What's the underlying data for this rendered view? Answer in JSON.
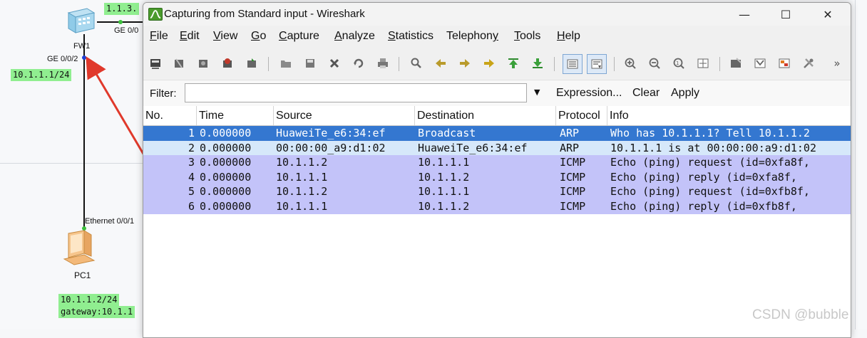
{
  "topology": {
    "fw_ip_label": "1.1.3.",
    "fw_port_top": "GE 0/0",
    "fw_name": "FW1",
    "fw_port_left": "GE 0/0/2",
    "fw_ip": "10.1.1.1/24",
    "pc_port": "Ethernet 0/0/1",
    "pc_name": "PC1",
    "pc_ip": "10.1.1.2/24",
    "pc_gateway": "gateway:10.1.1",
    "arrow_color": "#e0392b"
  },
  "window": {
    "title": "Capturing from Standard input - Wireshark",
    "minimize": "—",
    "maximize": "☐",
    "close": "✕"
  },
  "menu": [
    {
      "u": "F",
      "rest": "ile"
    },
    {
      "u": "E",
      "rest": "dit"
    },
    {
      "u": "V",
      "rest": "iew"
    },
    {
      "u": "G",
      "rest": "o"
    },
    {
      "u": "C",
      "rest": "apture"
    },
    {
      "u": "A",
      "rest": "nalyze"
    },
    {
      "u": "S",
      "rest": "tatistics"
    },
    {
      "pre": "Telephon",
      "u": "y",
      "rest": ""
    },
    {
      "u": "T",
      "rest": "ools"
    },
    {
      "u": "H",
      "rest": "elp"
    }
  ],
  "toolbar": {
    "icons": [
      "interfaces-icon",
      "options-icon",
      "start-capture-icon",
      "stop-capture-icon",
      "restart-capture-icon",
      "open-file-icon",
      "save-file-icon",
      "close-file-icon",
      "reload-icon",
      "print-icon",
      "find-packet-icon",
      "go-back-icon",
      "go-forward-icon",
      "go-to-packet-icon",
      "go-first-icon",
      "go-last-icon",
      "colorize-icon",
      "autoscroll-icon",
      "zoom-in-icon",
      "zoom-out-icon",
      "normal-size-icon",
      "resize-columns-icon",
      "capture-filters-icon",
      "display-filters-icon",
      "coloring-rules-icon",
      "preferences-icon"
    ],
    "more": "»"
  },
  "filter": {
    "label": "Filter:",
    "value": "",
    "dropdown": "▼",
    "expression": "Expression...",
    "clear": "Clear",
    "apply": "Apply"
  },
  "packet_list": {
    "columns": [
      "No.",
      "Time",
      "Source",
      "Destination",
      "Protocol",
      "Info"
    ],
    "rows": [
      {
        "no": "1",
        "time": "0.000000",
        "source": "HuaweiTe_e6:34:ef",
        "destination": "Broadcast",
        "protocol": "ARP",
        "info": "Who has 10.1.1.1?  Tell 10.1.1.2",
        "bg": "#3477d0",
        "fg": "#ffffff"
      },
      {
        "no": "2",
        "time": "0.000000",
        "source": "00:00:00_a9:d1:02",
        "destination": "HuaweiTe_e6:34:ef",
        "protocol": "ARP",
        "info": "10.1.1.1 is at 00:00:00:a9:d1:02",
        "bg": "#d6e8fa",
        "fg": "#111111"
      },
      {
        "no": "3",
        "time": "0.000000",
        "source": "10.1.1.2",
        "destination": "10.1.1.1",
        "protocol": "ICMP",
        "info": "Echo (ping) request  (id=0xfa8f,",
        "bg": "#c3c3f9",
        "fg": "#111111"
      },
      {
        "no": "4",
        "time": "0.000000",
        "source": "10.1.1.1",
        "destination": "10.1.1.2",
        "protocol": "ICMP",
        "info": "Echo (ping) reply    (id=0xfa8f,",
        "bg": "#c3c3f9",
        "fg": "#111111"
      },
      {
        "no": "5",
        "time": "0.000000",
        "source": "10.1.1.2",
        "destination": "10.1.1.1",
        "protocol": "ICMP",
        "info": "Echo (ping) request  (id=0xfb8f,",
        "bg": "#c3c3f9",
        "fg": "#111111"
      },
      {
        "no": "6",
        "time": "0.000000",
        "source": "10.1.1.1",
        "destination": "10.1.1.2",
        "protocol": "ICMP",
        "info": "Echo (ping) reply    (id=0xfb8f,",
        "bg": "#c3c3f9",
        "fg": "#111111"
      }
    ]
  },
  "watermark": "CSDN @bubble"
}
